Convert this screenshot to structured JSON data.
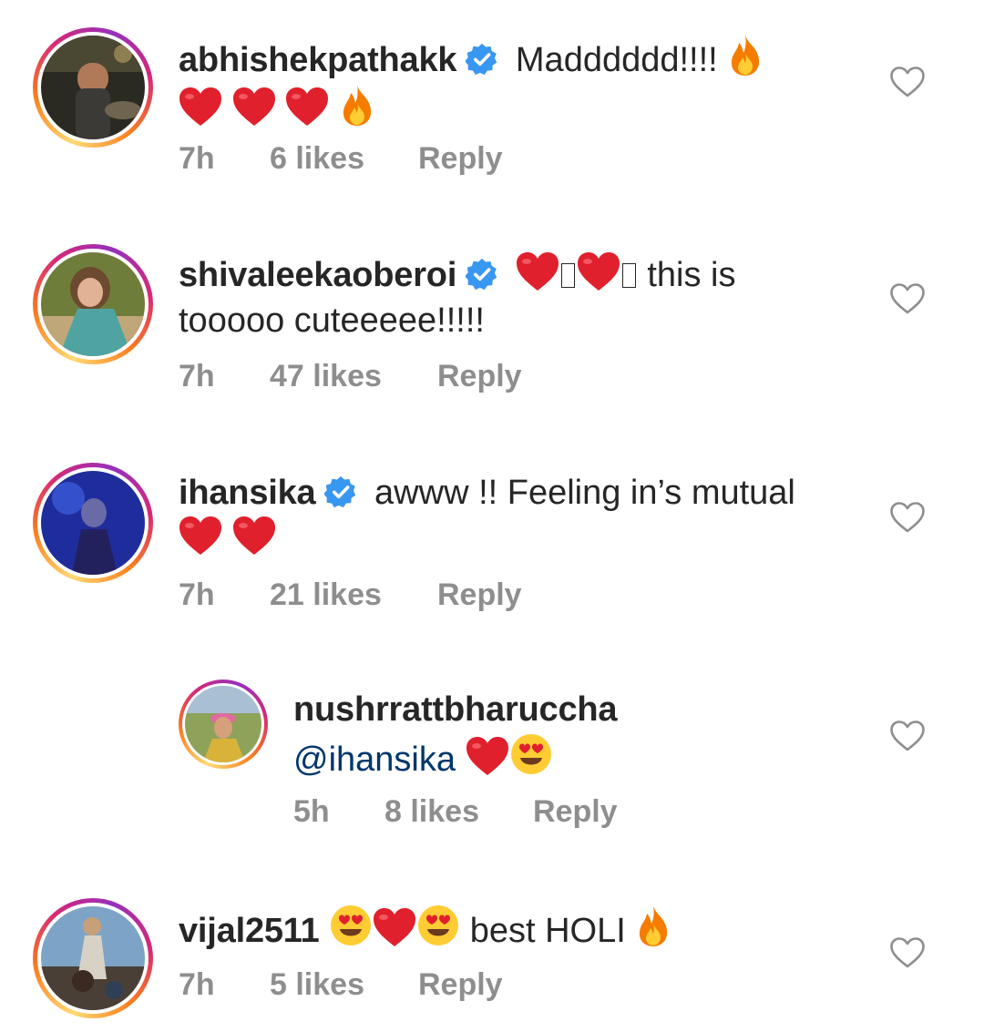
{
  "comments": [
    {
      "username": "abhishekpathakk",
      "verified": true,
      "text_1": "Madddddd!!!!",
      "time": "7h",
      "likes": "6 likes",
      "reply_label": "Reply"
    },
    {
      "username": "shivaleekaoberoi",
      "verified": true,
      "text_1": "this is",
      "text_2": "tooooo cuteeeee!!!!!",
      "time": "7h",
      "likes": "47 likes",
      "reply_label": "Reply"
    },
    {
      "username": "ihansika",
      "verified": true,
      "text_1": "awww !! Feeling in’s mutual",
      "time": "7h",
      "likes": "21 likes",
      "reply_label": "Reply"
    },
    {
      "username": "nushrrattbharuccha",
      "verified": false,
      "mention": "@ihansika",
      "time": "5h",
      "likes": "8 likes",
      "reply_label": "Reply"
    },
    {
      "username": "vijal2511",
      "verified": false,
      "text_1": "best HOLI",
      "time": "7h",
      "likes": "5 likes",
      "reply_label": "Reply"
    }
  ],
  "icons": {
    "verified": "verified-badge-icon",
    "like": "heart-outline-icon",
    "emoji_heart": "red-heart-emoji",
    "emoji_fire": "fire-emoji",
    "emoji_heart_eyes": "heart-eyes-emoji"
  },
  "colors": {
    "text": "#262626",
    "meta": "#8e8e8e",
    "mention": "#00376b",
    "verified": "#3897f0",
    "heart": "#e0202c"
  }
}
